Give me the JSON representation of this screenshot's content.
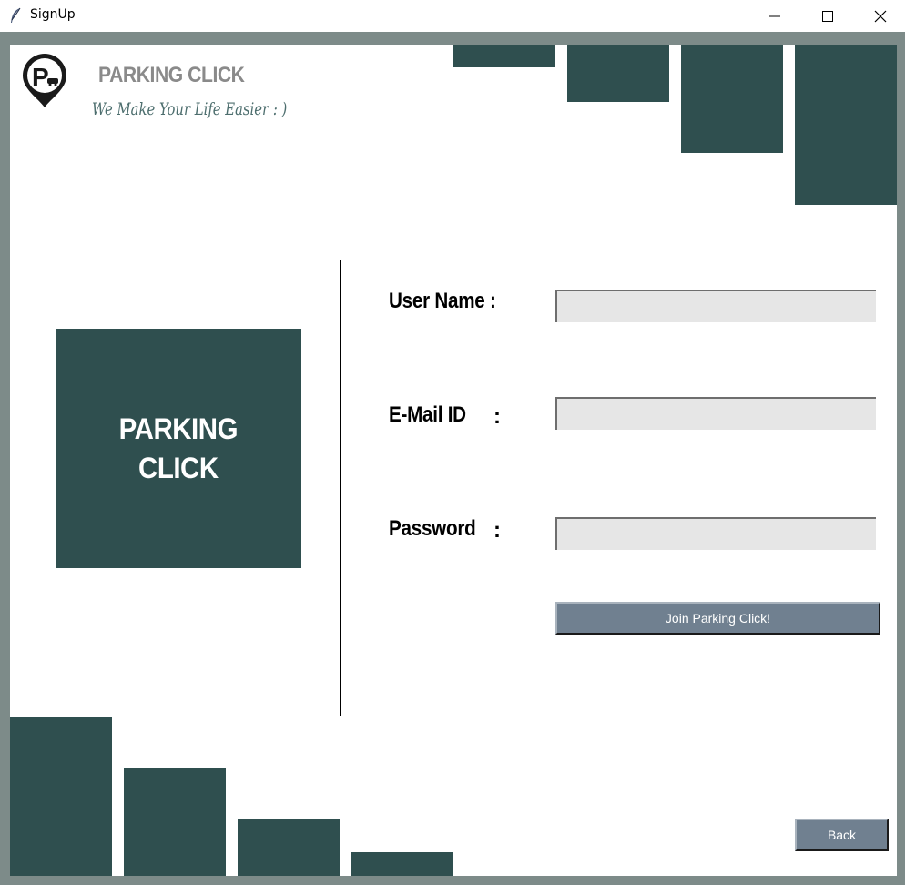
{
  "window": {
    "title": "SignUp",
    "icon": "feather-icon",
    "controls": [
      "minimize-icon",
      "maximize-icon",
      "close-icon"
    ]
  },
  "brand": {
    "name": "PARKING CLICK",
    "tagline": "We Make Your Life Easier : )",
    "logo_icon": "parking-pin-icon"
  },
  "panel": {
    "line1": "PARKING",
    "line2": "CLICK"
  },
  "form": {
    "username_label": "User Name :",
    "email_label": "E-Mail ID",
    "password_label": "Password",
    "colon": ":",
    "username_value": "",
    "email_value": "",
    "password_value": ""
  },
  "buttons": {
    "join": "Join Parking Click!",
    "back": "Back"
  },
  "colors": {
    "accent": "#2f4f4f",
    "button": "#708090",
    "frame": "#7d8b89",
    "field": "#e6e6e6"
  }
}
